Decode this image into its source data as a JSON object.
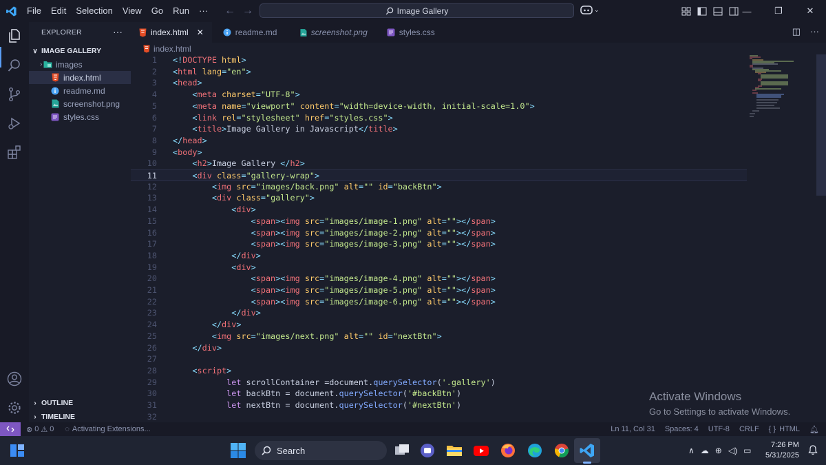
{
  "window": {
    "menu": [
      "File",
      "Edit",
      "Selection",
      "View",
      "Go",
      "Run",
      "···"
    ],
    "search_text": "Image Gallery"
  },
  "sidebar": {
    "header": "EXPLORER",
    "folder": "IMAGE GALLERY",
    "items": [
      {
        "label": "images",
        "type": "folder"
      },
      {
        "label": "index.html",
        "type": "html"
      },
      {
        "label": "readme.md",
        "type": "info"
      },
      {
        "label": "screenshot.png",
        "type": "image"
      },
      {
        "label": "styles.css",
        "type": "css"
      }
    ],
    "outline": "OUTLINE",
    "timeline": "TIMELINE"
  },
  "tabs": [
    {
      "label": "index.html",
      "icon": "html-icon"
    },
    {
      "label": "readme.md",
      "icon": "info-icon"
    },
    {
      "label": "screenshot.png",
      "icon": "image-icon"
    },
    {
      "label": "styles.css",
      "icon": "css-icon"
    }
  ],
  "breadcrumb": "index.html",
  "editor": {
    "current_line": 11,
    "lines": [
      [
        [
          "punc",
          "<!"
        ],
        [
          "tag",
          "DOCTYPE"
        ],
        [
          "plain",
          " "
        ],
        [
          "attr",
          "html"
        ],
        [
          "punc",
          ">"
        ]
      ],
      [
        [
          "punc",
          "<"
        ],
        [
          "tag",
          "html"
        ],
        [
          "plain",
          " "
        ],
        [
          "attr",
          "lang"
        ],
        [
          "punc",
          "="
        ],
        [
          "str",
          "\"en\""
        ],
        [
          "punc",
          ">"
        ]
      ],
      [
        [
          "punc",
          "<"
        ],
        [
          "tag",
          "head"
        ],
        [
          "punc",
          ">"
        ]
      ],
      [
        [
          "plain",
          "    "
        ],
        [
          "punc",
          "<"
        ],
        [
          "tag",
          "meta"
        ],
        [
          "plain",
          " "
        ],
        [
          "attr",
          "charset"
        ],
        [
          "punc",
          "="
        ],
        [
          "str",
          "\"UTF-8\""
        ],
        [
          "punc",
          ">"
        ]
      ],
      [
        [
          "plain",
          "    "
        ],
        [
          "punc",
          "<"
        ],
        [
          "tag",
          "meta"
        ],
        [
          "plain",
          " "
        ],
        [
          "attr",
          "name"
        ],
        [
          "punc",
          "="
        ],
        [
          "str",
          "\"viewport\""
        ],
        [
          "plain",
          " "
        ],
        [
          "attr",
          "content"
        ],
        [
          "punc",
          "="
        ],
        [
          "str",
          "\"width=device-width, initial-scale=1.0\""
        ],
        [
          "punc",
          ">"
        ]
      ],
      [
        [
          "plain",
          "    "
        ],
        [
          "punc",
          "<"
        ],
        [
          "tag",
          "link"
        ],
        [
          "plain",
          " "
        ],
        [
          "attr",
          "rel"
        ],
        [
          "punc",
          "="
        ],
        [
          "str",
          "\"stylesheet\""
        ],
        [
          "plain",
          " "
        ],
        [
          "attr",
          "href"
        ],
        [
          "punc",
          "="
        ],
        [
          "str",
          "\"styles.css\""
        ],
        [
          "punc",
          ">"
        ]
      ],
      [
        [
          "plain",
          "    "
        ],
        [
          "punc",
          "<"
        ],
        [
          "tag",
          "title"
        ],
        [
          "punc",
          ">"
        ],
        [
          "plain",
          "Image Gallery in Javascript"
        ],
        [
          "punc",
          "</"
        ],
        [
          "tag",
          "title"
        ],
        [
          "punc",
          ">"
        ]
      ],
      [
        [
          "punc",
          "</"
        ],
        [
          "tag",
          "head"
        ],
        [
          "punc",
          ">"
        ]
      ],
      [
        [
          "punc",
          "<"
        ],
        [
          "tag",
          "body"
        ],
        [
          "punc",
          ">"
        ]
      ],
      [
        [
          "plain",
          "    "
        ],
        [
          "punc",
          "<"
        ],
        [
          "tag",
          "h2"
        ],
        [
          "punc",
          ">"
        ],
        [
          "plain",
          "Image Gallery "
        ],
        [
          "punc",
          "</"
        ],
        [
          "tag",
          "h2"
        ],
        [
          "punc",
          ">"
        ]
      ],
      [
        [
          "plain",
          "    "
        ],
        [
          "punc",
          "<"
        ],
        [
          "tag",
          "div"
        ],
        [
          "plain",
          " "
        ],
        [
          "attr",
          "class"
        ],
        [
          "punc",
          "="
        ],
        [
          "str",
          "\"gallery-wrap\""
        ],
        [
          "punc",
          ">"
        ]
      ],
      [
        [
          "plain",
          "        "
        ],
        [
          "punc",
          "<"
        ],
        [
          "tag",
          "img"
        ],
        [
          "plain",
          " "
        ],
        [
          "attr",
          "src"
        ],
        [
          "punc",
          "="
        ],
        [
          "str",
          "\"images/back.png\""
        ],
        [
          "plain",
          " "
        ],
        [
          "attr",
          "alt"
        ],
        [
          "punc",
          "="
        ],
        [
          "str",
          "\"\""
        ],
        [
          "plain",
          " "
        ],
        [
          "attr",
          "id"
        ],
        [
          "punc",
          "="
        ],
        [
          "str",
          "\"backBtn\""
        ],
        [
          "punc",
          ">"
        ]
      ],
      [
        [
          "plain",
          "        "
        ],
        [
          "punc",
          "<"
        ],
        [
          "tag",
          "div"
        ],
        [
          "plain",
          " "
        ],
        [
          "attr",
          "class"
        ],
        [
          "punc",
          "="
        ],
        [
          "str",
          "\"gallery\""
        ],
        [
          "punc",
          ">"
        ]
      ],
      [
        [
          "plain",
          "            "
        ],
        [
          "punc",
          "<"
        ],
        [
          "tag",
          "div"
        ],
        [
          "punc",
          ">"
        ]
      ],
      [
        [
          "plain",
          "                "
        ],
        [
          "punc",
          "<"
        ],
        [
          "tag",
          "span"
        ],
        [
          "punc",
          "><"
        ],
        [
          "tag",
          "img"
        ],
        [
          "plain",
          " "
        ],
        [
          "attr",
          "src"
        ],
        [
          "punc",
          "="
        ],
        [
          "str",
          "\"images/image-1.png\""
        ],
        [
          "plain",
          " "
        ],
        [
          "attr",
          "alt"
        ],
        [
          "punc",
          "="
        ],
        [
          "str",
          "\"\""
        ],
        [
          "punc",
          "></"
        ],
        [
          "tag",
          "span"
        ],
        [
          "punc",
          ">"
        ]
      ],
      [
        [
          "plain",
          "                "
        ],
        [
          "punc",
          "<"
        ],
        [
          "tag",
          "span"
        ],
        [
          "punc",
          "><"
        ],
        [
          "tag",
          "img"
        ],
        [
          "plain",
          " "
        ],
        [
          "attr",
          "src"
        ],
        [
          "punc",
          "="
        ],
        [
          "str",
          "\"images/image-2.png\""
        ],
        [
          "plain",
          " "
        ],
        [
          "attr",
          "alt"
        ],
        [
          "punc",
          "="
        ],
        [
          "str",
          "\"\""
        ],
        [
          "punc",
          "></"
        ],
        [
          "tag",
          "span"
        ],
        [
          "punc",
          ">"
        ]
      ],
      [
        [
          "plain",
          "                "
        ],
        [
          "punc",
          "<"
        ],
        [
          "tag",
          "span"
        ],
        [
          "punc",
          "><"
        ],
        [
          "tag",
          "img"
        ],
        [
          "plain",
          " "
        ],
        [
          "attr",
          "src"
        ],
        [
          "punc",
          "="
        ],
        [
          "str",
          "\"images/image-3.png\""
        ],
        [
          "plain",
          " "
        ],
        [
          "attr",
          "alt"
        ],
        [
          "punc",
          "="
        ],
        [
          "str",
          "\"\""
        ],
        [
          "punc",
          "></"
        ],
        [
          "tag",
          "span"
        ],
        [
          "punc",
          ">"
        ]
      ],
      [
        [
          "plain",
          "            "
        ],
        [
          "punc",
          "</"
        ],
        [
          "tag",
          "div"
        ],
        [
          "punc",
          ">"
        ]
      ],
      [
        [
          "plain",
          "            "
        ],
        [
          "punc",
          "<"
        ],
        [
          "tag",
          "div"
        ],
        [
          "punc",
          ">"
        ]
      ],
      [
        [
          "plain",
          "                "
        ],
        [
          "punc",
          "<"
        ],
        [
          "tag",
          "span"
        ],
        [
          "punc",
          "><"
        ],
        [
          "tag",
          "img"
        ],
        [
          "plain",
          " "
        ],
        [
          "attr",
          "src"
        ],
        [
          "punc",
          "="
        ],
        [
          "str",
          "\"images/image-4.png\""
        ],
        [
          "plain",
          " "
        ],
        [
          "attr",
          "alt"
        ],
        [
          "punc",
          "="
        ],
        [
          "str",
          "\"\""
        ],
        [
          "punc",
          "></"
        ],
        [
          "tag",
          "span"
        ],
        [
          "punc",
          ">"
        ]
      ],
      [
        [
          "plain",
          "                "
        ],
        [
          "punc",
          "<"
        ],
        [
          "tag",
          "span"
        ],
        [
          "punc",
          "><"
        ],
        [
          "tag",
          "img"
        ],
        [
          "plain",
          " "
        ],
        [
          "attr",
          "src"
        ],
        [
          "punc",
          "="
        ],
        [
          "str",
          "\"images/image-5.png\""
        ],
        [
          "plain",
          " "
        ],
        [
          "attr",
          "alt"
        ],
        [
          "punc",
          "="
        ],
        [
          "str",
          "\"\""
        ],
        [
          "punc",
          "></"
        ],
        [
          "tag",
          "span"
        ],
        [
          "punc",
          ">"
        ]
      ],
      [
        [
          "plain",
          "                "
        ],
        [
          "punc",
          "<"
        ],
        [
          "tag",
          "span"
        ],
        [
          "punc",
          "><"
        ],
        [
          "tag",
          "img"
        ],
        [
          "plain",
          " "
        ],
        [
          "attr",
          "src"
        ],
        [
          "punc",
          "="
        ],
        [
          "str",
          "\"images/image-6.png\""
        ],
        [
          "plain",
          " "
        ],
        [
          "attr",
          "alt"
        ],
        [
          "punc",
          "="
        ],
        [
          "str",
          "\"\""
        ],
        [
          "punc",
          "></"
        ],
        [
          "tag",
          "span"
        ],
        [
          "punc",
          ">"
        ]
      ],
      [
        [
          "plain",
          "            "
        ],
        [
          "punc",
          "</"
        ],
        [
          "tag",
          "div"
        ],
        [
          "punc",
          ">"
        ]
      ],
      [
        [
          "plain",
          "        "
        ],
        [
          "punc",
          "</"
        ],
        [
          "tag",
          "div"
        ],
        [
          "punc",
          ">"
        ]
      ],
      [
        [
          "plain",
          "        "
        ],
        [
          "punc",
          "<"
        ],
        [
          "tag",
          "img"
        ],
        [
          "plain",
          " "
        ],
        [
          "attr",
          "src"
        ],
        [
          "punc",
          "="
        ],
        [
          "str",
          "\"images/next.png\""
        ],
        [
          "plain",
          " "
        ],
        [
          "attr",
          "alt"
        ],
        [
          "punc",
          "="
        ],
        [
          "str",
          "\"\""
        ],
        [
          "plain",
          " "
        ],
        [
          "attr",
          "id"
        ],
        [
          "punc",
          "="
        ],
        [
          "str",
          "\"nextBtn\""
        ],
        [
          "punc",
          ">"
        ]
      ],
      [
        [
          "plain",
          "    "
        ],
        [
          "punc",
          "</"
        ],
        [
          "tag",
          "div"
        ],
        [
          "punc",
          ">"
        ]
      ],
      [],
      [
        [
          "plain",
          "    "
        ],
        [
          "punc",
          "<"
        ],
        [
          "tag",
          "script"
        ],
        [
          "punc",
          ">"
        ]
      ],
      [
        [
          "plain",
          "           "
        ],
        [
          "kw",
          "let"
        ],
        [
          "plain",
          " scrollContainer ="
        ],
        [
          "plain",
          "document."
        ],
        [
          "fn",
          "querySelector"
        ],
        [
          "plain",
          "("
        ],
        [
          "str",
          "'.gallery'"
        ],
        [
          "plain",
          ")"
        ]
      ],
      [
        [
          "plain",
          "           "
        ],
        [
          "kw",
          "let"
        ],
        [
          "plain",
          " backBtn = document."
        ],
        [
          "fn",
          "querySelector"
        ],
        [
          "plain",
          "("
        ],
        [
          "str",
          "'#backBtn'"
        ],
        [
          "plain",
          ")"
        ]
      ],
      [
        [
          "plain",
          "           "
        ],
        [
          "kw",
          "let"
        ],
        [
          "plain",
          " nextBtn = document."
        ],
        [
          "fn",
          "querySelector"
        ],
        [
          "plain",
          "("
        ],
        [
          "str",
          "'#nextBtn'"
        ],
        [
          "plain",
          ")"
        ]
      ],
      []
    ]
  },
  "watermark": {
    "line1": "Activate Windows",
    "line2": "Go to Settings to activate Windows."
  },
  "status": {
    "problems": "0",
    "warnings": "0",
    "activity": "Activating Extensions...",
    "position": "Ln 11, Col 31",
    "indent": "Spaces: 4",
    "encoding": "UTF-8",
    "eol": "CRLF",
    "language": "HTML"
  },
  "taskbar": {
    "search": "Search",
    "time": "7:26 PM",
    "date": "5/31/2025"
  },
  "colors": {
    "accent": "#5b9ef5",
    "remote": "#7e57c2"
  }
}
